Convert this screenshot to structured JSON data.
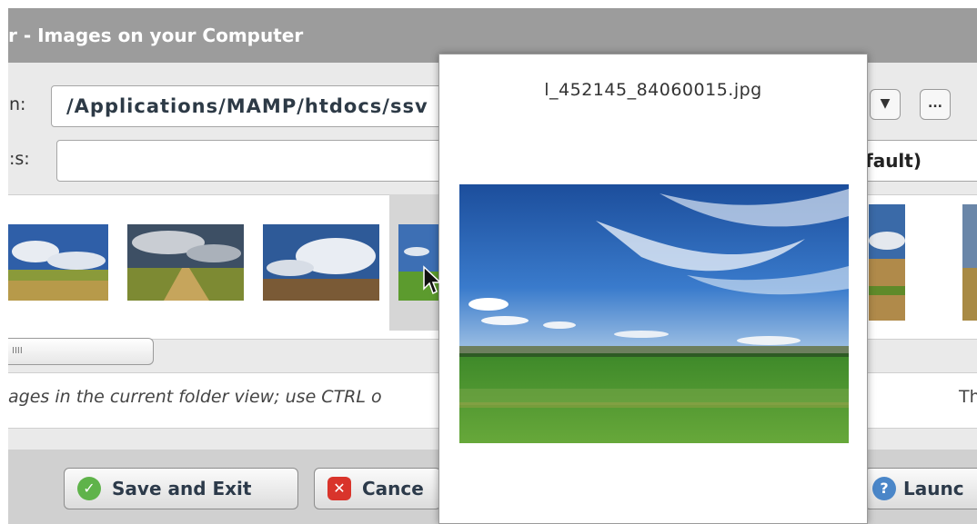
{
  "window": {
    "title": "r - Images on your Computer"
  },
  "folder": {
    "label": "n:",
    "path": "/Applications/MAMP/htdocs/ssv"
  },
  "files": {
    "label": ":s:",
    "value": ""
  },
  "buttons": {
    "dropdown_glyph": "▼",
    "browse_label": "...",
    "mode_value": "fault)"
  },
  "status": {
    "text": "ages in the current folder view; use CTRL o",
    "right_text": "Th",
    "scroll_grip": "IIII"
  },
  "actions": {
    "save_label": "Save and Exit",
    "cancel_label": "Cance",
    "launch_label": "Launc"
  },
  "preview": {
    "filename": "l_452145_84060015.jpg"
  },
  "icons": [
    "check-circle-icon",
    "close-circle-icon",
    "help-circle-icon",
    "chevron-down-icon",
    "ellipsis-icon"
  ],
  "colors": {
    "titlebar": "#9c9c9c",
    "save_icon": "#5fb34a",
    "cancel_icon": "#d9342b",
    "launch_icon": "#4a86c8"
  }
}
